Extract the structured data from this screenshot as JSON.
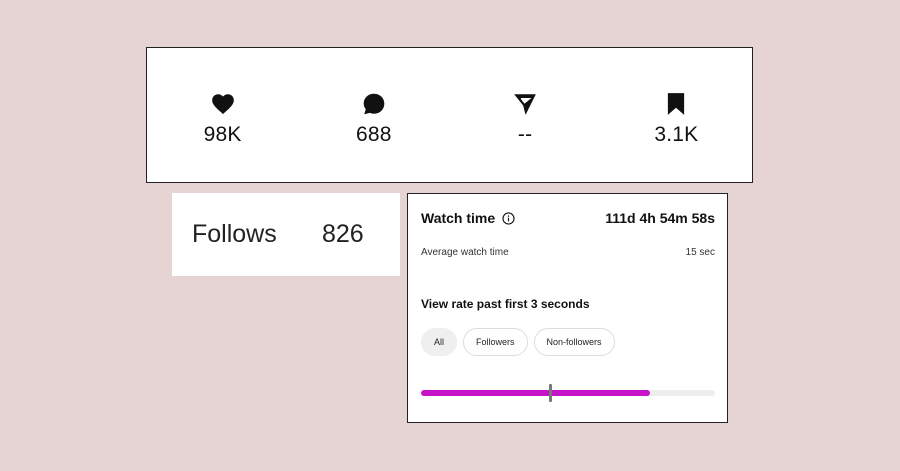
{
  "stats": [
    {
      "icon": "heart-icon",
      "value": "98K"
    },
    {
      "icon": "comment-icon",
      "value": "688"
    },
    {
      "icon": "share-icon",
      "value": "--"
    },
    {
      "icon": "bookmark-icon",
      "value": "3.1K"
    }
  ],
  "follows": {
    "label": "Follows",
    "count": "826"
  },
  "watch_time": {
    "title": "Watch time",
    "total": "111d 4h 54m 58s",
    "average_label": "Average watch time",
    "average_value": "15 sec",
    "view_rate_title": "View rate past first 3 seconds",
    "filters": [
      "All",
      "Followers",
      "Non-followers"
    ],
    "active_filter": "All",
    "progress_fill_fraction": 0.78,
    "progress_marker_fraction": 0.44,
    "accent_color": "#c413c9"
  }
}
